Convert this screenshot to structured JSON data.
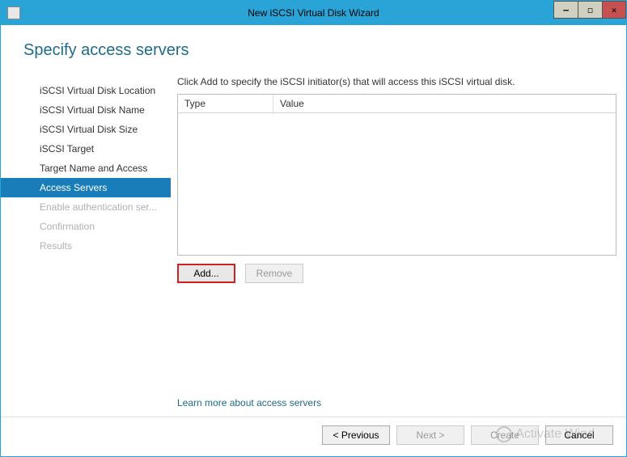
{
  "titlebar": {
    "title": "New iSCSI Virtual Disk Wizard"
  },
  "page": {
    "title": "Specify access servers",
    "instruction": "Click Add to specify the iSCSI initiator(s) that will access this iSCSI virtual disk."
  },
  "sidebar": {
    "items": [
      {
        "label": "iSCSI Virtual Disk Location",
        "state": "normal"
      },
      {
        "label": "iSCSI Virtual Disk Name",
        "state": "normal"
      },
      {
        "label": "iSCSI Virtual Disk Size",
        "state": "normal"
      },
      {
        "label": "iSCSI Target",
        "state": "normal"
      },
      {
        "label": "Target Name and Access",
        "state": "normal"
      },
      {
        "label": "Access Servers",
        "state": "active"
      },
      {
        "label": "Enable authentication ser...",
        "state": "disabled"
      },
      {
        "label": "Confirmation",
        "state": "disabled"
      },
      {
        "label": "Results",
        "state": "disabled"
      }
    ]
  },
  "table": {
    "columns": {
      "type": "Type",
      "value": "Value"
    },
    "rows": []
  },
  "buttons": {
    "add": "Add...",
    "remove": "Remove"
  },
  "link": {
    "learn_more": "Learn more about access servers"
  },
  "footer": {
    "previous": "< Previous",
    "next": "Next >",
    "create": "Create",
    "cancel": "Cancel"
  },
  "watermark": "Activate Wind"
}
